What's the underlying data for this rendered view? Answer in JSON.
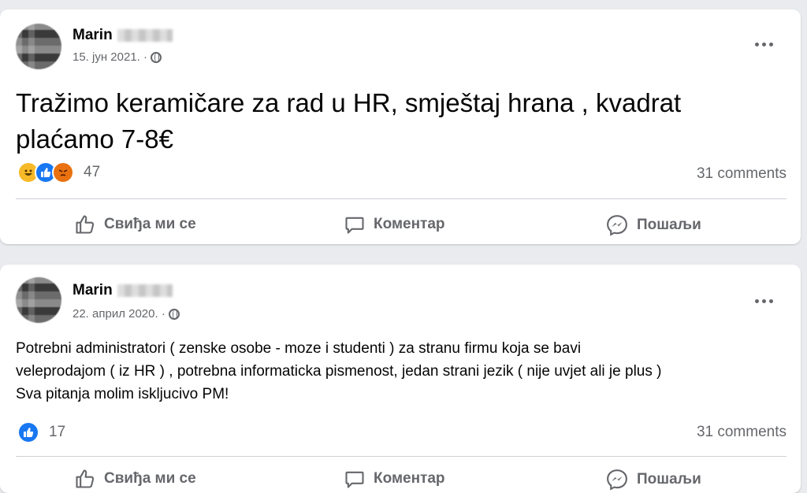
{
  "posts": [
    {
      "author": "Marin",
      "date": "15. јун 2021. ·",
      "text": "Tražimo keramičare za rad u HR, smještaj hrana , kvadrat plaćamo 7-8€",
      "reactions": [
        "haha-icon",
        "like-icon",
        "angry-icon"
      ],
      "reaction_count": "47",
      "comments": "31 comments"
    },
    {
      "author": "Marin",
      "date": "22. април 2020. ·",
      "text_lines": [
        "Potrebni administratori ( zenske osobe - moze i studenti ) za stranu firmu koja se bavi",
        "veleprodajom ( iz HR ) , potrebna informaticka pismenost, jedan strani jezik ( nije uvjet ali je plus )",
        "Sva pitanja molim iskljucivo PM!"
      ],
      "reactions": [
        "like-icon"
      ],
      "reaction_count": "17",
      "comments": "31 comments"
    }
  ],
  "actions": {
    "like": "Свиђа ми се",
    "comment": "Коментар",
    "share": "Пошаљи"
  },
  "colors": {
    "background": "#e9ebee",
    "card": "#ffffff",
    "secondary_text": "#65676b",
    "like_blue": "#1877f2",
    "haha_yellow": "#f7b928",
    "angry_orange": "#e9710f"
  }
}
